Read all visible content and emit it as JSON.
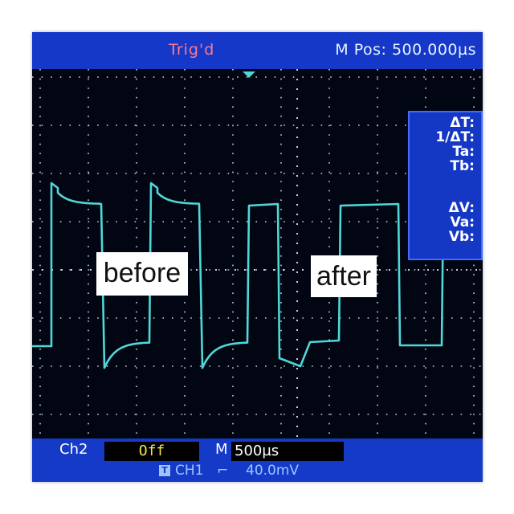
{
  "status": {
    "trigger_state": "Trig'd",
    "horizontal_position": "M Pos: 500.000µs"
  },
  "cursor_panel": {
    "labels": [
      "ΔT:",
      "1/ΔT:",
      "Ta:",
      "Tb:",
      "ΔV:",
      "Va:",
      "Vb:"
    ]
  },
  "annotations": {
    "before": "before",
    "after": "after"
  },
  "bottom": {
    "ch2_label": "Ch2",
    "ch2_state": "Off",
    "timebase_prefix": "M",
    "timebase_value": "500µs",
    "trigger_icon": "T",
    "trigger_source": "CH1",
    "trigger_slope": "⌐",
    "trigger_level": "40.0mV"
  },
  "colors": {
    "trace": "#4fd8d8",
    "grid": "#c8d2e0",
    "panel_blue": "#1638c8",
    "trig_text": "#ff7a8a",
    "off_text": "#f6e840"
  }
}
